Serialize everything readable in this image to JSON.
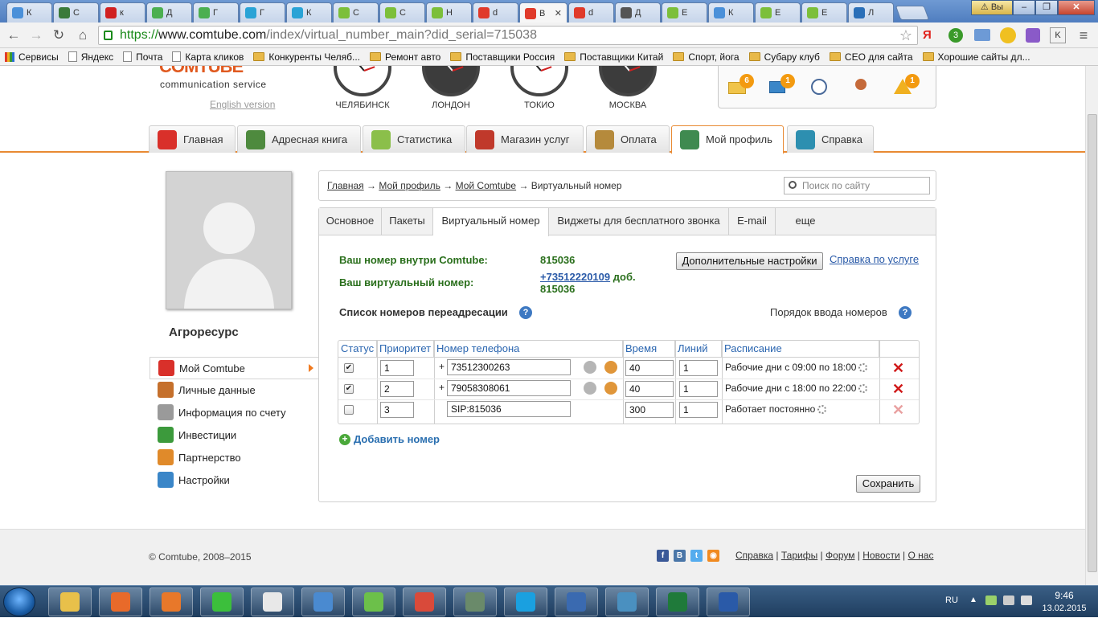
{
  "browser": {
    "tabs": [
      {
        "label": "К",
        "color": "#4a90d9"
      },
      {
        "label": "С",
        "color": "#3a7a3a"
      },
      {
        "label": "к",
        "color": "#d02020"
      },
      {
        "label": "Д",
        "color": "#4caf50"
      },
      {
        "label": "Г",
        "color": "#4caf50"
      },
      {
        "label": "Г",
        "color": "#29a3d6"
      },
      {
        "label": "К",
        "color": "#29a3d6"
      },
      {
        "label": "С",
        "color": "#7cbf3a"
      },
      {
        "label": "С",
        "color": "#7cbf3a"
      },
      {
        "label": "Н",
        "color": "#7cbf3a"
      },
      {
        "label": "d",
        "color": "#e03a2a"
      },
      {
        "label": "В",
        "color": "#e03a2a"
      },
      {
        "label": "d",
        "color": "#e03a2a"
      },
      {
        "label": "Д",
        "color": "#555555"
      },
      {
        "label": "Е",
        "color": "#7cbf3a"
      },
      {
        "label": "К",
        "color": "#4a90d9"
      },
      {
        "label": "Е",
        "color": "#7cbf3a"
      },
      {
        "label": "Е",
        "color": "#7cbf3a"
      },
      {
        "label": "Л",
        "color": "#2a6fb8"
      }
    ],
    "window_user": "Вы",
    "url_scheme": "https://",
    "url_host": "www.comtube.com",
    "url_rest": "/index/virtual_number_main?did_serial=715038",
    "bookmarks": [
      {
        "label": "Сервисы",
        "type": "apps"
      },
      {
        "label": "Яндекс",
        "type": "page"
      },
      {
        "label": "Почта",
        "type": "page"
      },
      {
        "label": "Карта кликов",
        "type": "page"
      },
      {
        "label": "Конкуренты Челяб...",
        "type": "folder"
      },
      {
        "label": "Ремонт авто",
        "type": "folder"
      },
      {
        "label": "Поставщики Россия",
        "type": "folder"
      },
      {
        "label": "Поставщики Китай",
        "type": "folder"
      },
      {
        "label": "Спорт, йога",
        "type": "folder"
      },
      {
        "label": "Субару клуб",
        "type": "folder"
      },
      {
        "label": "СЕО для сайта",
        "type": "folder"
      },
      {
        "label": "Хорошие сайты дл...",
        "type": "folder"
      }
    ]
  },
  "header": {
    "logo_text": "COMTUBE",
    "logo_sub": "communication service",
    "english_link": "English version",
    "clocks": [
      {
        "city": "ЧЕЛЯБИНСК",
        "theme": "light"
      },
      {
        "city": "ЛОНДОН",
        "theme": "dark"
      },
      {
        "city": "ТОКИО",
        "theme": "light"
      },
      {
        "city": "МОСКВА",
        "theme": "dark"
      }
    ],
    "notify": {
      "mail_count": "6",
      "monitor_count": "1",
      "alert_count": "1"
    }
  },
  "main_nav": [
    {
      "label": "Главная",
      "color": "#d9302a"
    },
    {
      "label": "Адресная книга",
      "color": "#4e8a3e"
    },
    {
      "label": "Статистика",
      "color": "#8bbf4a"
    },
    {
      "label": "Магазин услуг",
      "color": "#c0392b"
    },
    {
      "label": "Оплата",
      "color": "#b58a3c"
    },
    {
      "label": "Мой профиль",
      "color": "#3f8a50"
    },
    {
      "label": "Справка",
      "color": "#2d8fb0"
    }
  ],
  "sidebar": {
    "company": "Агроресурс",
    "items": [
      {
        "label": "Мой Comtube",
        "color": "#d9302a"
      },
      {
        "label": "Личные данные",
        "color": "#c5702c"
      },
      {
        "label": "Информация по счету",
        "color": "#9a9a9a"
      },
      {
        "label": "Инвестиции",
        "color": "#3c9a3c"
      },
      {
        "label": "Партнерство",
        "color": "#e08a2a"
      },
      {
        "label": "Настройки",
        "color": "#3a86c8"
      }
    ]
  },
  "breadcrumb": {
    "home": "Главная",
    "profile": "Мой профиль",
    "comtube": "Мой Comtube",
    "current": "Виртуальный номер",
    "search_placeholder": "Поиск по сайту"
  },
  "subtabs": [
    "Основное",
    "Пакеты",
    "Виртуальный номер",
    "Виджеты для бесплатного звонка",
    "E-mail",
    "еще"
  ],
  "info": {
    "internal_label": "Ваш номер внутри Comtube:",
    "internal_value": "815036",
    "virtual_label": "Ваш виртуальный номер:",
    "virtual_number": "+73512220109",
    "virtual_ext_label": "доб.",
    "virtual_ext": "815036",
    "settings_button": "Дополнительные настройки",
    "help_link": "Справка по услуге"
  },
  "forwarding": {
    "title": "Список номеров переадресации",
    "input_order": "Порядок ввода номеров",
    "columns": [
      "Статус",
      "Приоритет",
      "Номер телефона",
      "Время",
      "Линий",
      "Расписание"
    ],
    "rows": [
      {
        "checked": true,
        "priority": "1",
        "plus": "+",
        "phone": "73512300263",
        "time": "40",
        "lines": "1",
        "schedule": "Рабочие дни с 09:00 по 18:00"
      },
      {
        "checked": true,
        "priority": "2",
        "plus": "+",
        "phone": "79058308061",
        "time": "40",
        "lines": "1",
        "schedule": "Рабочие дни с 18:00 по 22:00"
      },
      {
        "checked": false,
        "priority": "3",
        "plus": "",
        "phone": "SIP:815036",
        "time": "300",
        "lines": "1",
        "schedule": "Работает постоянно"
      }
    ],
    "add_label": "Добавить номер",
    "save_button": "Сохранить"
  },
  "footer": {
    "copyright": "© Comtube, 2008–2015",
    "links": [
      "Справка",
      "Тарифы",
      "Форум",
      "Новости",
      "О нас"
    ]
  },
  "taskbar": {
    "apps": [
      {
        "name": "explorer",
        "color": "#e8c04a"
      },
      {
        "name": "media",
        "color": "#e86a2a"
      },
      {
        "name": "firefox",
        "color": "#e8782a"
      },
      {
        "name": "icq",
        "color": "#3cbf3c"
      },
      {
        "name": "yandex",
        "color": "#e8e8e8"
      },
      {
        "name": "sound",
        "color": "#4a8ad0"
      },
      {
        "name": "agent",
        "color": "#6cc04a"
      },
      {
        "name": "chrome",
        "color": "#d94a3a"
      },
      {
        "name": "terminal",
        "color": "#6a8a6a"
      },
      {
        "name": "skype",
        "color": "#1aa0e0"
      },
      {
        "name": "thunderbird",
        "color": "#3a6ab0"
      },
      {
        "name": "photos",
        "color": "#4a90c0"
      },
      {
        "name": "excel",
        "color": "#1f7a3a"
      },
      {
        "name": "word",
        "color": "#2a5aa8"
      }
    ],
    "lang": "RU",
    "time": "9:46",
    "date": "13.02.2015"
  }
}
